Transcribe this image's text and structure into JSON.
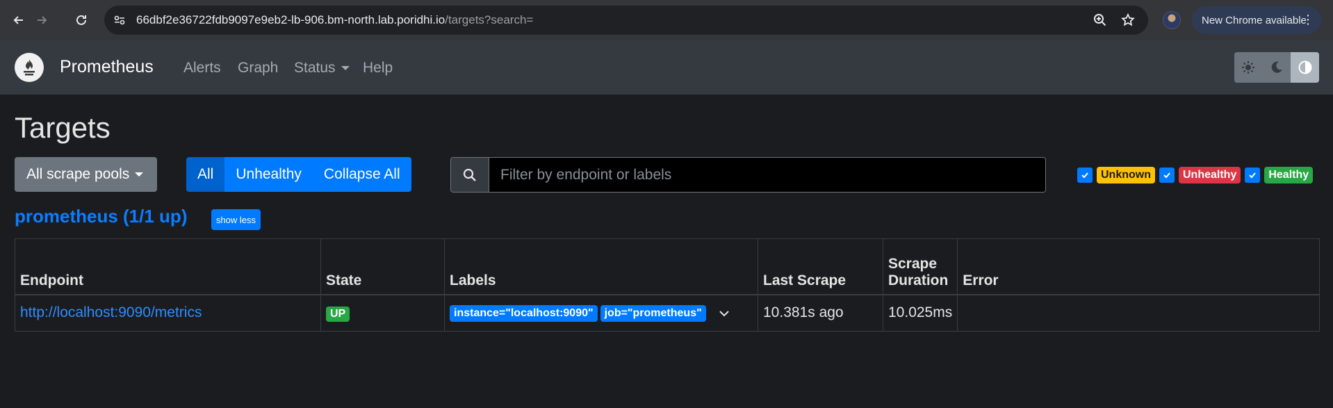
{
  "browser": {
    "url_host": "66dbf2e36722fdb9097e9eb2-lb-906.bm-north.lab.poridhi.io",
    "url_path": "/targets?search=",
    "update_label": "New Chrome available",
    "update_menu": "⋮"
  },
  "navbar": {
    "brand": "Prometheus",
    "links": [
      "Alerts",
      "Graph",
      "Status",
      "Help"
    ]
  },
  "page": {
    "title": "Targets",
    "pools_button": "All scrape pools",
    "filters": [
      "All",
      "Unhealthy",
      "Collapse All"
    ],
    "search_placeholder": "Filter by endpoint or labels",
    "health": [
      "Unknown",
      "Unhealthy",
      "Healthy"
    ]
  },
  "pool": {
    "title": "prometheus (1/1 up)",
    "toggle_label": "show less",
    "columns": [
      "Endpoint",
      "State",
      "Labels",
      "Last Scrape",
      "Scrape Duration",
      "Error"
    ],
    "rows": [
      {
        "endpoint": "http://localhost:9090/metrics",
        "state": "UP",
        "labels": [
          "instance=\"localhost:9090\"",
          "job=\"prometheus\""
        ],
        "last_scrape": "10.381s ago",
        "duration": "10.025ms",
        "error": ""
      }
    ]
  },
  "colors": {
    "accent": "#007bff",
    "up": "#28a745",
    "unknown": "#ffc107",
    "unhealthy": "#dc3545"
  }
}
